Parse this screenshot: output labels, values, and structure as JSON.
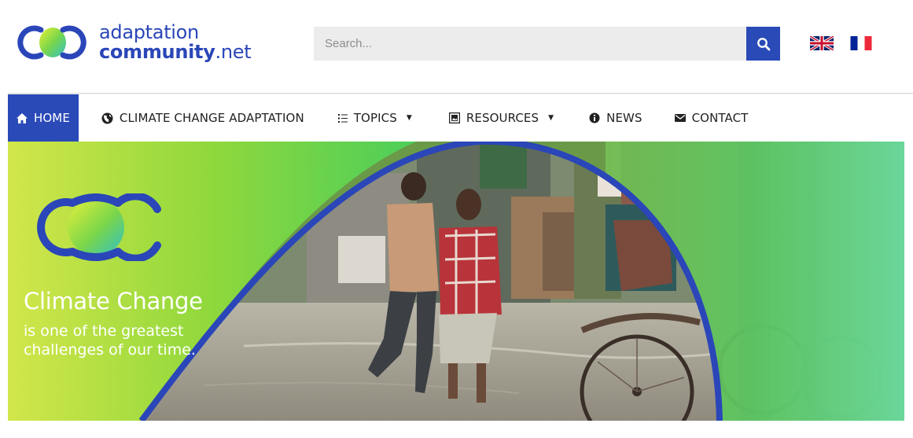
{
  "site": {
    "logo_line1": "adaptation",
    "logo_line2_bold": "community",
    "logo_line2_suffix": ".net",
    "logo_icon": "infinity-loop-logo-icon"
  },
  "search": {
    "placeholder": "Search...",
    "button_icon": "search-icon"
  },
  "languages": [
    {
      "code": "en",
      "icon": "uk-flag-icon"
    },
    {
      "code": "fr",
      "icon": "french-flag-icon"
    }
  ],
  "nav": {
    "items": [
      {
        "label": "HOME",
        "icon": "home-icon",
        "active": true
      },
      {
        "label": "CLIMATE CHANGE ADAPTATION",
        "icon": "globe-icon"
      },
      {
        "label": "TOPICS",
        "icon": "list-icon",
        "dropdown": true
      },
      {
        "label": "RESOURCES",
        "icon": "image-gallery-icon",
        "dropdown": true
      },
      {
        "label": "NEWS",
        "icon": "info-icon"
      },
      {
        "label": "CONTACT",
        "icon": "envelope-icon"
      }
    ]
  },
  "hero": {
    "title": "Climate Change",
    "subtitle": "is one of the greatest challenges of our time.",
    "image": "flooded-street-photo"
  },
  "colors": {
    "brand_blue": "#2a4ab8",
    "hero_green": "#86d641",
    "hero_yellow": "#d8e84a"
  }
}
